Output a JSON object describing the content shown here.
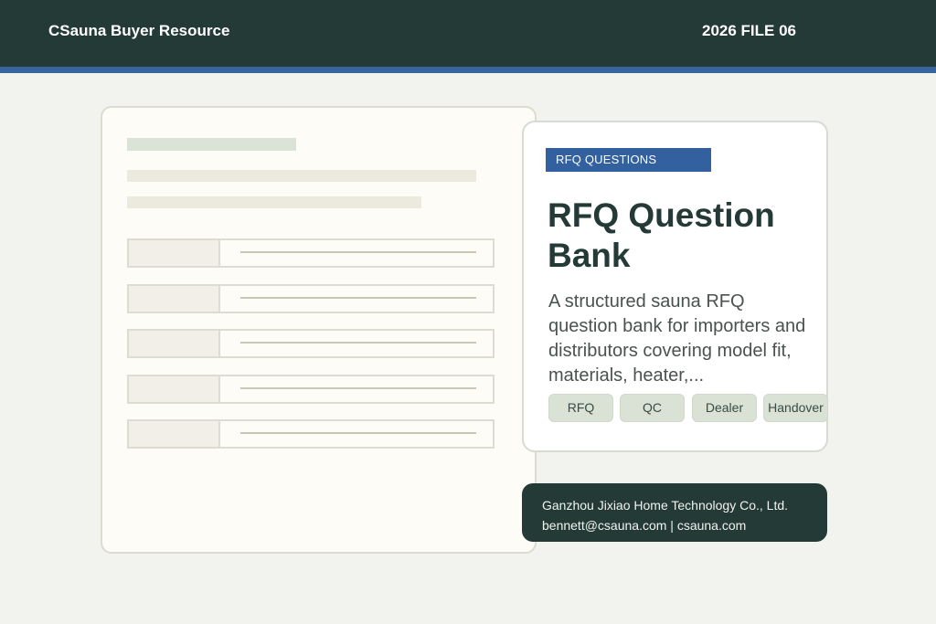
{
  "header": {
    "brand": "CSauna Buyer Resource",
    "file_label": "2026 FILE 06"
  },
  "card": {
    "badge": "RFQ QUESTIONS",
    "title": "RFQ Question Bank",
    "description": "A structured sauna RFQ question bank for importers and distributors covering model fit, materials, heater,...",
    "tags": [
      "RFQ",
      "QC",
      "Dealer",
      "Handover"
    ]
  },
  "contact": {
    "company": "Ganzhou Jixiao Home Technology Co., Ltd.",
    "email_site": "bennett@csauna.com | csauna.com"
  },
  "colors": {
    "header_bg": "#243a36",
    "accent": "#3a64a0",
    "badge_bg": "#33609e",
    "tag_bg": "#d9e2d5",
    "page_bg": "#f2f3ef"
  }
}
